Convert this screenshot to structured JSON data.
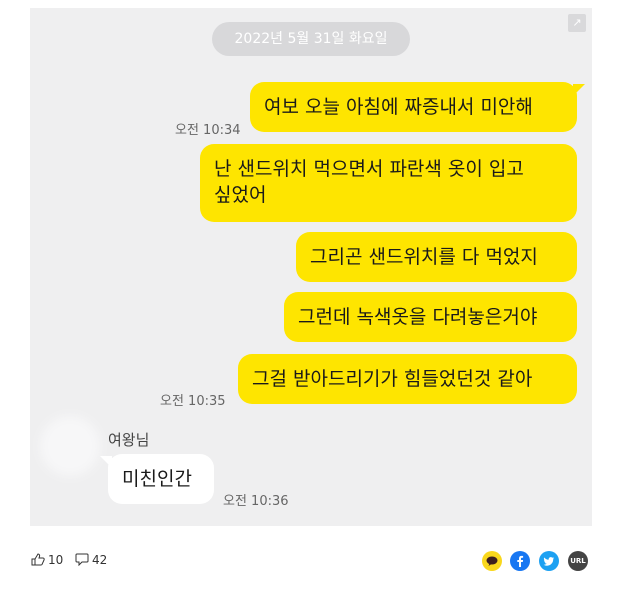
{
  "chat": {
    "date": "2022년 5월 31일 화요일",
    "expand_icon": "↗",
    "messages": [
      {
        "text": "여보 오늘 아침에 짜증내서 미안해",
        "time": "오전 10:34"
      },
      {
        "line1": "난 샌드위치 먹으면서 파란색 옷이 입고",
        "line2": "싶었어"
      },
      {
        "text": "그리곤 샌드위치를 다 먹었지"
      },
      {
        "text": "그런데 녹색옷을 다려놓은거야"
      },
      {
        "text": "그걸 받아드리기가 힘들었던것 같아",
        "time": "오전 10:35"
      }
    ],
    "reply": {
      "sender": "여왕님",
      "text": "미친인간",
      "time": "오전 10:36"
    }
  },
  "footer": {
    "like_icon": "thumbs-up-icon",
    "like_count": "10",
    "comment_icon": "comment-icon",
    "comment_count": "42",
    "share": [
      {
        "name": "kakaotalk-share-icon",
        "color": "#f9d71c"
      },
      {
        "name": "facebook-share-icon",
        "color": "#1877f2"
      },
      {
        "name": "twitter-share-icon",
        "color": "#1da1f2"
      },
      {
        "name": "url-share-icon",
        "color": "#444444",
        "label": "URL"
      }
    ]
  }
}
